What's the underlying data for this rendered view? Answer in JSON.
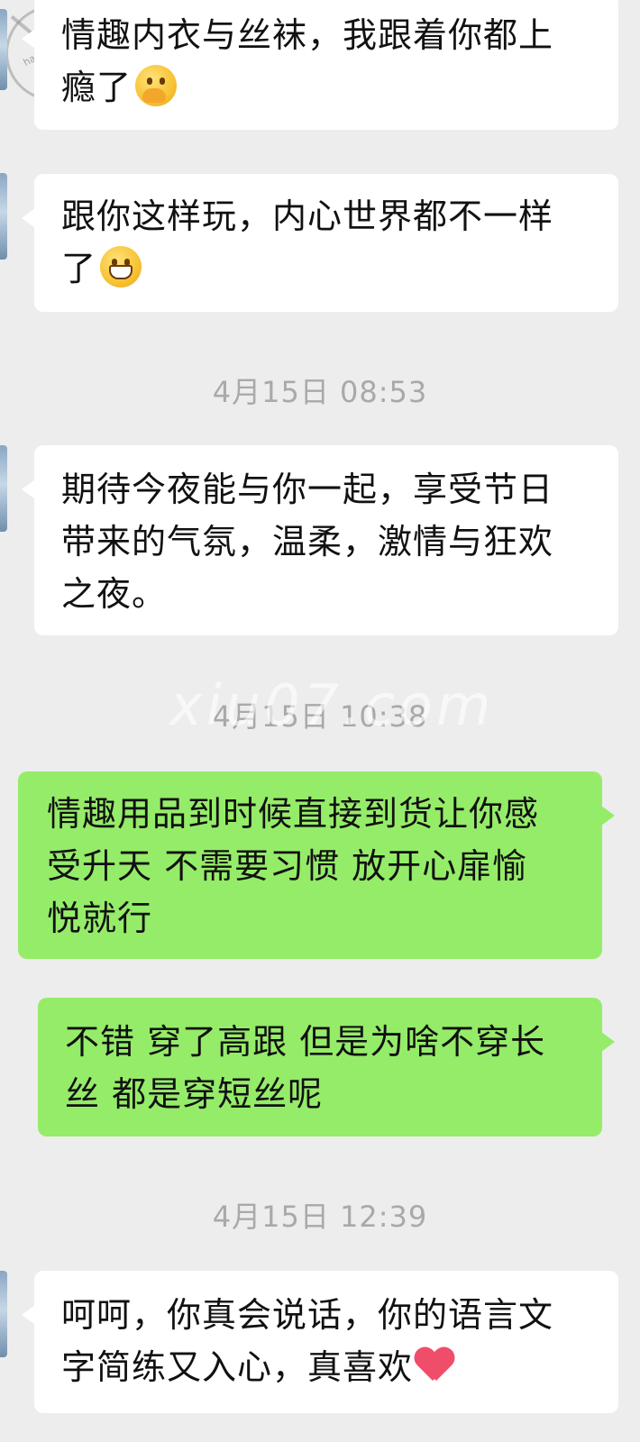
{
  "messages": [
    {
      "kind": "in",
      "lines": [
        "情趣内衣与丝袜，我跟着你都上",
        "瘾了"
      ],
      "emoji": "hand-over-mouth-icon"
    },
    {
      "kind": "in",
      "lines": [
        "跟你这样玩，内心世界都不一样",
        "了"
      ],
      "emoji": "grinning-icon"
    },
    {
      "kind": "time",
      "text": "4月15日 08:53"
    },
    {
      "kind": "in",
      "lines": [
        "期待今夜能与你一起，享受节日",
        "带来的气氛，温柔，激情与狂欢",
        "之夜。"
      ]
    },
    {
      "kind": "time",
      "text": "4月15日 10:38"
    },
    {
      "kind": "out",
      "lines": [
        "情趣用品到时候直接到货让你感",
        "受升天 不需要习惯 放开心扉愉",
        "悦就行"
      ]
    },
    {
      "kind": "out",
      "lines": [
        "不错 穿了高跟 但是为啥不穿长",
        "丝 都是穿短丝呢"
      ]
    },
    {
      "kind": "time",
      "text": "4月15日 12:39"
    },
    {
      "kind": "in",
      "lines": [
        "呵呵，你真会说话，你的语言文",
        "字简练又入心，真喜欢"
      ],
      "emoji": "heart-icon"
    }
  ],
  "watermark": "xiu07.com",
  "logo_text": "haijiao.com"
}
